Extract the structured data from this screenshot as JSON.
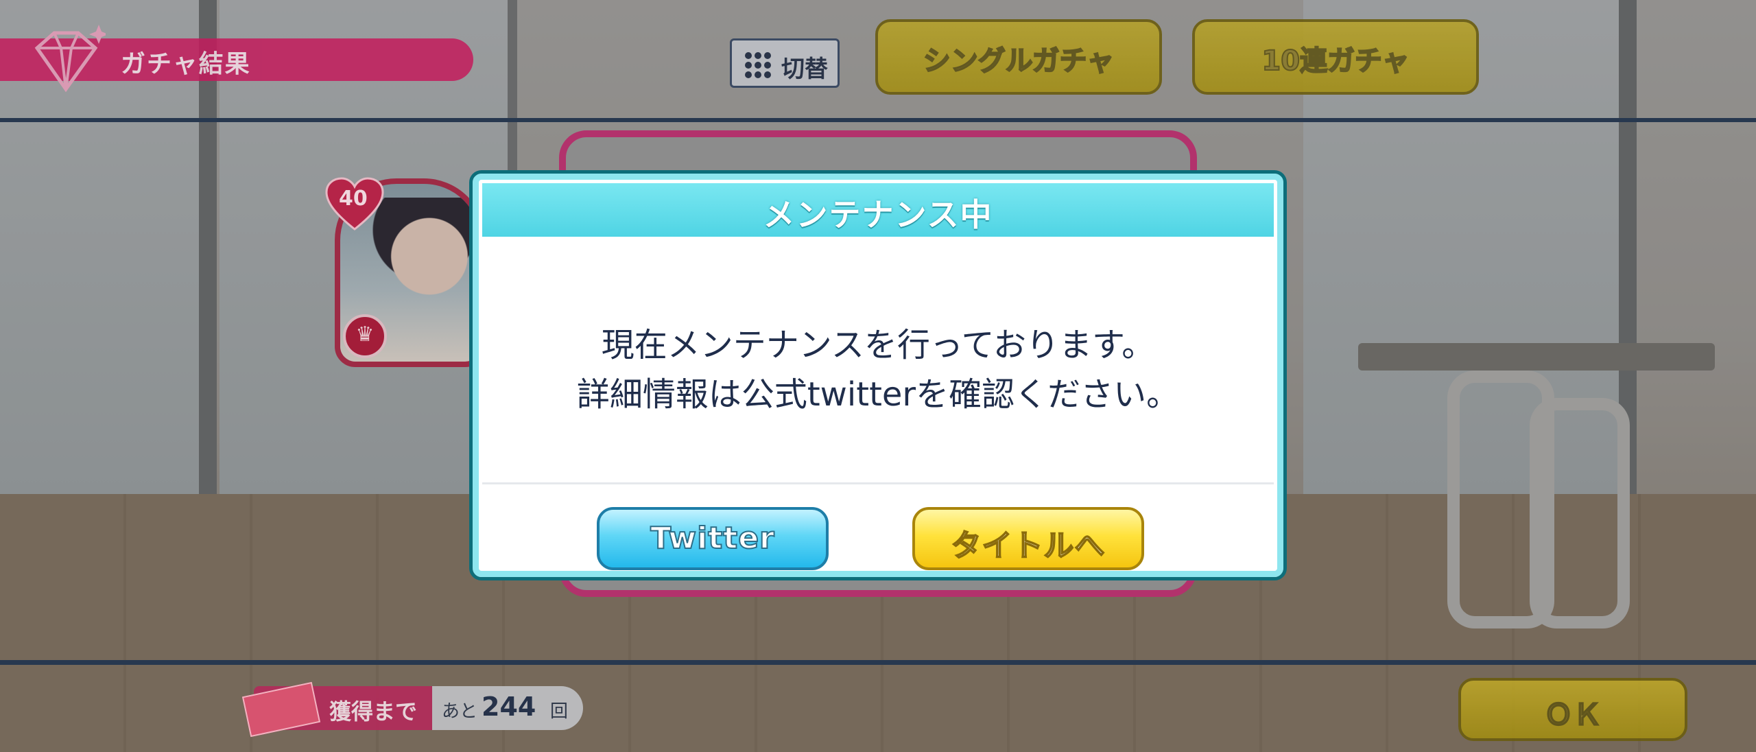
{
  "header": {
    "title": "ガチャ結果",
    "switch_label": "切替",
    "single_gacha": "シングルガチャ",
    "ten_gacha": "10連ガチャ"
  },
  "character_card": {
    "level": "40",
    "crown_icon": "crown-icon"
  },
  "footer": {
    "get_label": "獲得まで",
    "remaining_prefix": "あと",
    "remaining_count": "244",
    "remaining_suffix": "回",
    "ok_label": "ＯＫ"
  },
  "dialog": {
    "title": "メンテナンス中",
    "message_line1": "現在メンテナンスを行っております。",
    "message_line2": "詳細情報は公式twitterを確認ください。",
    "twitter_button": "Twitter",
    "title_button": "タイトルへ"
  },
  "colors": {
    "dialog_header": "#4fd4e4",
    "twitter_button": "#24b9ec",
    "title_button": "#ffe23c",
    "banner": "#c31b5c"
  }
}
